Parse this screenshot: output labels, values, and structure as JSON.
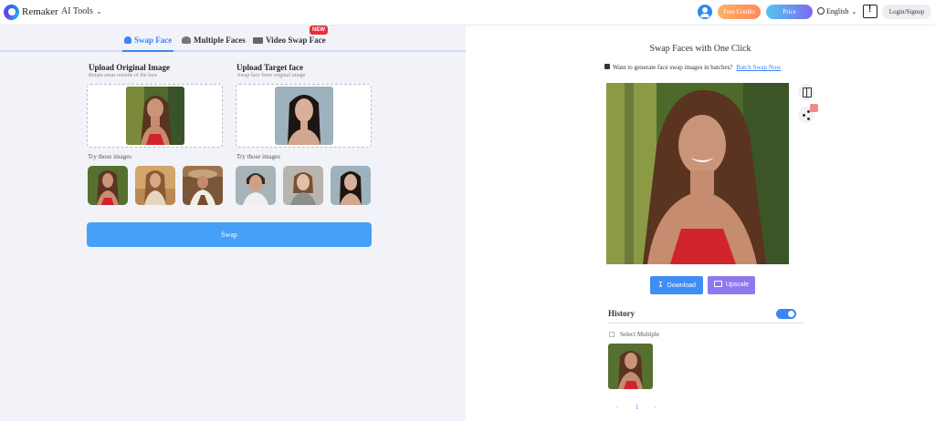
{
  "header": {
    "brand": "Remaker",
    "ai_tools": "AI Tools",
    "free_credits": "Free Credits",
    "price": "Price",
    "language": "English",
    "login": "Login/Signup"
  },
  "tabs": [
    {
      "label": "Swap Face",
      "active": true
    },
    {
      "label": "Multiple Faces",
      "active": false
    },
    {
      "label": "Video Swap Face",
      "active": false,
      "badge": "NEW"
    }
  ],
  "upload_original": {
    "title": "Upload Original Image",
    "subtitle": "Retain areas outside of the face",
    "try_label": "Try those images"
  },
  "upload_target": {
    "title": "Upload Target face",
    "subtitle": "Swap face from original image",
    "try_label": "Try those images"
  },
  "swap_button": "Swap",
  "result": {
    "title": "Swap Faces with One Click",
    "batch_question": "Want to generate face swap images in batches?",
    "batch_link": "Batch Swap Now",
    "download": "Download",
    "upscale": "Upscale"
  },
  "history": {
    "title": "History",
    "toggle_on": true,
    "select_multiple": "Select Multiple",
    "page": "1"
  },
  "colors": {
    "accent": "#3a86f4",
    "swap_button": "#46a0f8",
    "upscale": "#8f78ef",
    "new_badge": "#e5303a"
  }
}
